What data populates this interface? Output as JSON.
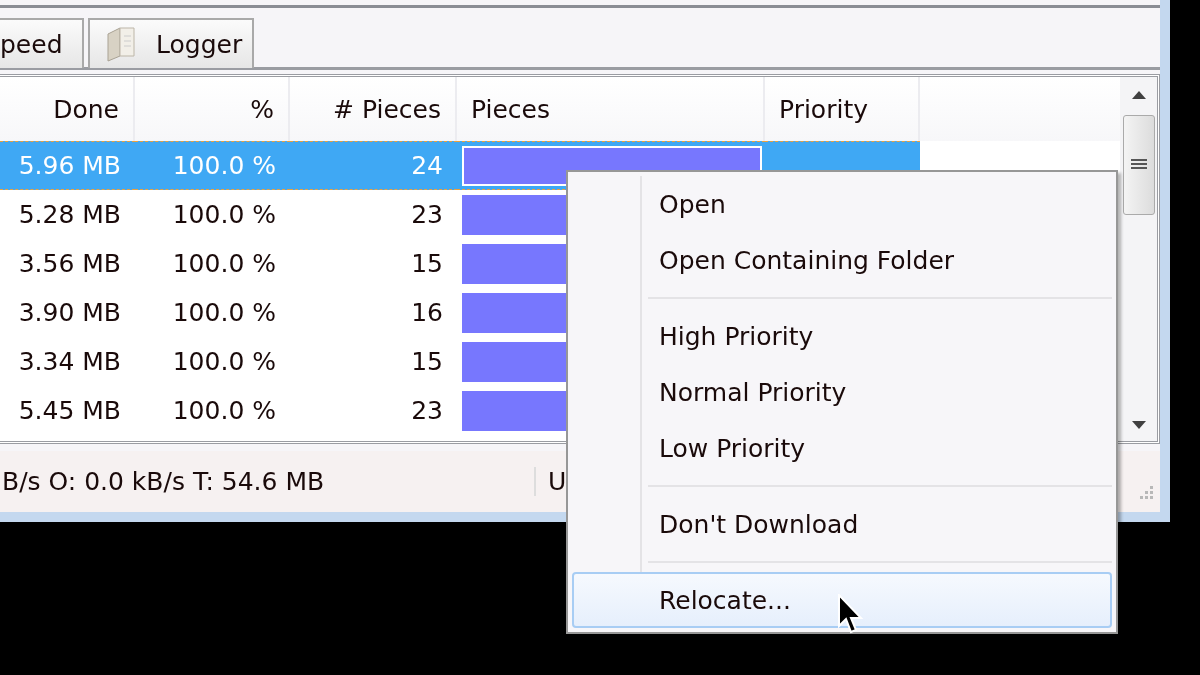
{
  "tabs": [
    {
      "label": "peed",
      "selected": false,
      "icon": false
    },
    {
      "label": "Logger",
      "selected": false,
      "icon": true
    }
  ],
  "table": {
    "columns": [
      "Done",
      "%",
      "# Pieces",
      "Pieces",
      "Priority"
    ],
    "rows": [
      {
        "done": "5.96 MB",
        "percent": "100.0 %",
        "pieces_count": "24",
        "level": 1,
        "selected": true
      },
      {
        "done": "5.28 MB",
        "percent": "100.0 %",
        "pieces_count": "23",
        "level": 1,
        "selected": false
      },
      {
        "done": "3.56 MB",
        "percent": "100.0 %",
        "pieces_count": "15",
        "level": 1,
        "selected": false
      },
      {
        "done": "3.90 MB",
        "percent": "100.0 %",
        "pieces_count": "16",
        "level": 1,
        "selected": false
      },
      {
        "done": "3.34 MB",
        "percent": "100.0 %",
        "pieces_count": "15",
        "level": 1,
        "selected": false
      },
      {
        "done": "5.45 MB",
        "percent": "100.0 %",
        "pieces_count": "23",
        "level": 1,
        "selected": false
      }
    ]
  },
  "status_bar": [
    "B/s O: 0.0 kB/s T: 54.6 MB",
    "U"
  ],
  "context_menu": [
    {
      "kind": "item",
      "label": "Open",
      "highlighted": false
    },
    {
      "kind": "item",
      "label": "Open Containing Folder",
      "highlighted": false
    },
    {
      "kind": "separator"
    },
    {
      "kind": "item",
      "label": "High Priority",
      "highlighted": false
    },
    {
      "kind": "item",
      "label": "Normal Priority",
      "highlighted": false
    },
    {
      "kind": "item",
      "label": "Low Priority",
      "highlighted": false
    },
    {
      "kind": "separator"
    },
    {
      "kind": "item",
      "label": "Don't Download",
      "highlighted": false
    },
    {
      "kind": "separator"
    },
    {
      "kind": "item",
      "label": "Relocate...",
      "highlighted": true
    }
  ]
}
